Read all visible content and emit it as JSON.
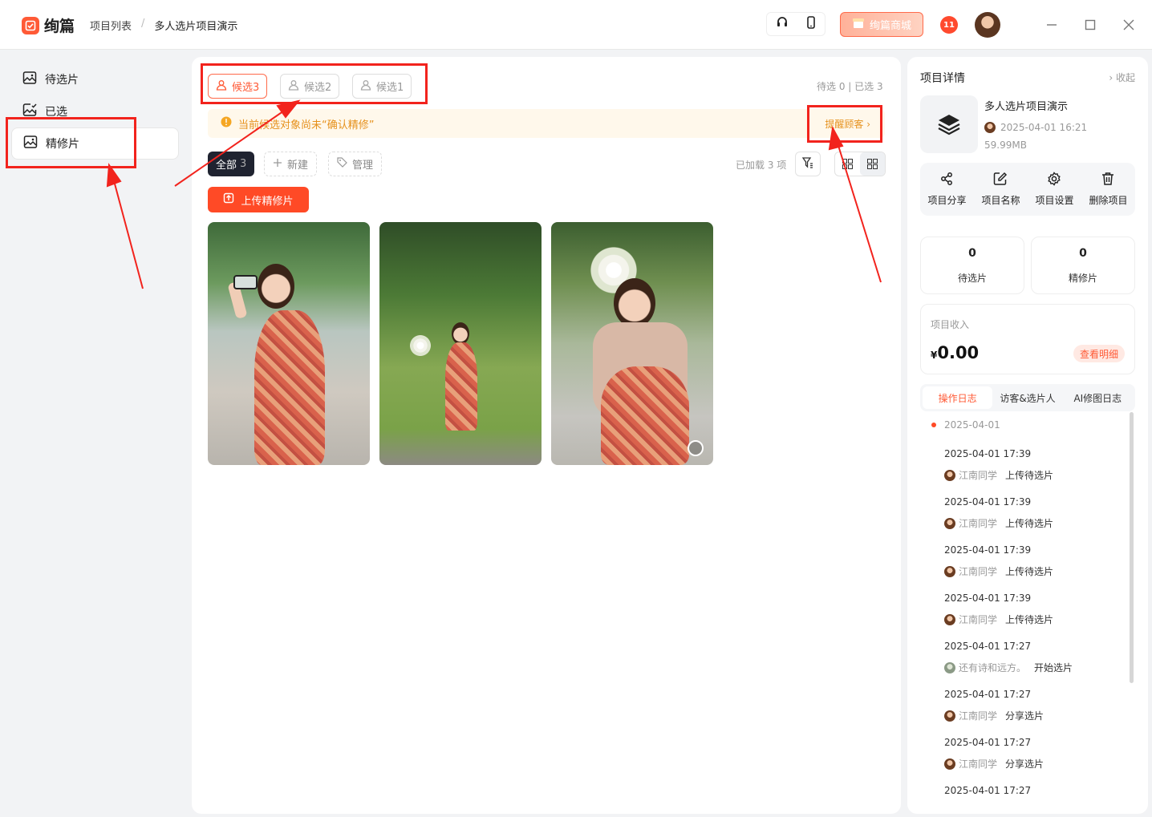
{
  "app": {
    "logo_text": "绚篇",
    "brand_color": "#ff5a36"
  },
  "breadcrumb": {
    "item1": "项目列表",
    "separator": "/",
    "item2": "多人选片项目演示"
  },
  "topbar": {
    "shop_label": "绚篇商城",
    "notification_badge": "11",
    "headset_icon": "headset-icon",
    "phone_icon": "phone-icon"
  },
  "sidebar": {
    "items": [
      {
        "label": "待选片",
        "icon": "image-icon"
      },
      {
        "label": "已选",
        "icon": "image-check-icon"
      },
      {
        "label": "精修片",
        "icon": "image-icon",
        "active": true
      }
    ]
  },
  "main": {
    "candidate_tabs": [
      {
        "label": "候选3",
        "active": true
      },
      {
        "label": "候选2"
      },
      {
        "label": "候选1"
      }
    ],
    "counts": {
      "pending": "待选 0",
      "divider": "|",
      "selected": "已选 3"
    },
    "notice": {
      "text": "当前候选对象尚未“确认精修”",
      "link": "提醒顾客"
    },
    "filters": {
      "all_label": "全部",
      "all_count": "3",
      "new_label": "新建",
      "manage_label": "管理"
    },
    "loaded_text": "已加载 3 项",
    "upload_label": "上传精修片",
    "photos": 3
  },
  "right_panel": {
    "title": "项目详情",
    "collapse": "收起",
    "project_name": "多人选片项目演示",
    "project_date": "2025-04-01 16:21",
    "project_size": "59.99MB",
    "actions": [
      {
        "label": "项目分享",
        "icon": "share-icon"
      },
      {
        "label": "项目名称",
        "icon": "edit-icon"
      },
      {
        "label": "项目设置",
        "icon": "gear-icon"
      },
      {
        "label": "删除项目",
        "icon": "trash-icon"
      }
    ],
    "stats": [
      {
        "value": "0",
        "label": "待选片"
      },
      {
        "value": "0",
        "label": "精修片"
      }
    ],
    "income": {
      "label": "项目收入",
      "currency": "¥",
      "amount": "0.00",
      "detail_label": "查看明细"
    },
    "log_tabs": [
      {
        "label": "操作日志",
        "active": true
      },
      {
        "label": "访客&选片人"
      },
      {
        "label": "AI修图日志"
      }
    ],
    "log_day": "2025-04-01",
    "logs": [
      {
        "time": "2025-04-01 17:39",
        "user": "江南同学",
        "action": "上传待选片"
      },
      {
        "time": "2025-04-01 17:39",
        "user": "江南同学",
        "action": "上传待选片"
      },
      {
        "time": "2025-04-01 17:39",
        "user": "江南同学",
        "action": "上传待选片"
      },
      {
        "time": "2025-04-01 17:39",
        "user": "江南同学",
        "action": "上传待选片"
      },
      {
        "time": "2025-04-01 17:27",
        "user": "还有诗和远方。",
        "action": "开始选片"
      },
      {
        "time": "2025-04-01 17:27",
        "user": "江南同学",
        "action": "分享选片"
      },
      {
        "time": "2025-04-01 17:27",
        "user": "江南同学",
        "action": "分享选片"
      },
      {
        "time": "2025-04-01 17:27",
        "user": "",
        "action": ""
      }
    ]
  },
  "annotation_color": "#f2231d"
}
